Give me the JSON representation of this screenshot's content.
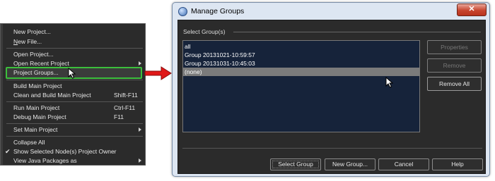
{
  "menu": {
    "items": [
      {
        "label": "New Project...",
        "shortcut": "",
        "submenu": false
      },
      {
        "label": "New File...",
        "shortcut": "",
        "submenu": false
      },
      {
        "label": "Open Project...",
        "shortcut": "",
        "submenu": false
      },
      {
        "label": "Open Recent Project",
        "shortcut": "",
        "submenu": true
      },
      {
        "label": "Project Groups...",
        "shortcut": "",
        "submenu": false,
        "highlighted": true
      },
      {
        "label": "Build Main Project",
        "shortcut": "",
        "submenu": false
      },
      {
        "label": "Clean and Build Main Project",
        "shortcut": "Shift-F11",
        "submenu": false
      },
      {
        "label": "Run Main Project",
        "shortcut": "Ctrl-F11",
        "submenu": false
      },
      {
        "label": "Debug Main Project",
        "shortcut": "F11",
        "submenu": false
      },
      {
        "label": "Set Main Project",
        "shortcut": "",
        "submenu": true
      },
      {
        "label": "Collapse All",
        "shortcut": "",
        "submenu": false
      },
      {
        "label": "Show Selected Node(s) Project Owner",
        "shortcut": "",
        "submenu": false,
        "checked": true
      },
      {
        "label": "View Java Packages as",
        "shortcut": "",
        "submenu": true
      }
    ],
    "check_glyph": "✔"
  },
  "dialog": {
    "title": "Manage Groups",
    "close_glyph": "✕",
    "section_label": "Select Group(s)",
    "groups": [
      "all",
      "Group 20131021-10:59:57",
      "Group 20131031-10:45:03",
      "(none)"
    ],
    "selected_index": 3,
    "side_buttons": {
      "properties": "Properties",
      "remove": "Remove",
      "remove_all": "Remove All"
    },
    "buttons": {
      "select_group": "Select Group",
      "new_group": "New Group...",
      "cancel": "Cancel",
      "help": "Help"
    }
  },
  "colors": {
    "highlight_border": "#3cbf3c",
    "arrow": "#e01818",
    "list_bg": "#16233a",
    "selected_row": "#7b7b7b"
  }
}
